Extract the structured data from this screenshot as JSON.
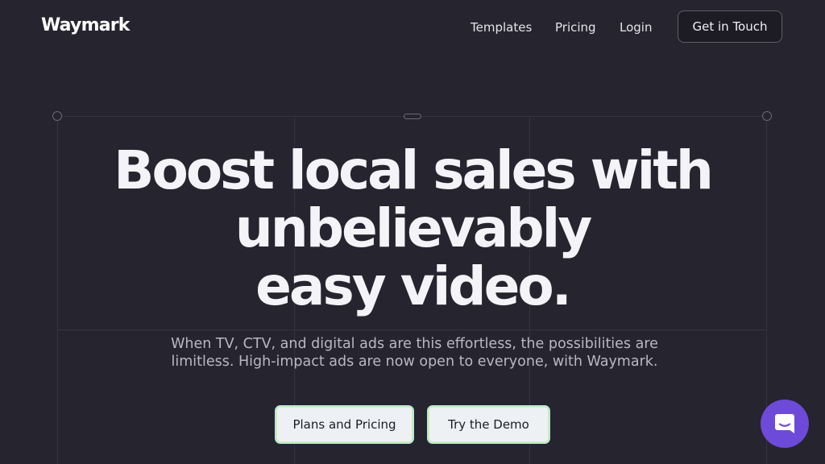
{
  "header": {
    "logo_text": "Waymark",
    "nav": {
      "templates": "Templates",
      "pricing": "Pricing",
      "login": "Login"
    },
    "cta_label": "Get in Touch"
  },
  "hero": {
    "title_line1": "Boost local sales with",
    "title_line2": "unbelievably",
    "title_line3": "easy video.",
    "subtitle_line1": "When TV, CTV, and digital ads are this effortless, the possibilities are",
    "subtitle_line2": "limitless. High-impact ads are now open to everyone, with Waymark.",
    "primary_button": "Plans and Pricing",
    "secondary_button": "Try the Demo"
  },
  "chat_widget": {
    "icon": "chat-icon",
    "color": "#6e4ad8"
  },
  "colors": {
    "background": "#25242f",
    "text": "#f4f4f8",
    "button_bg": "#eef1f4"
  }
}
